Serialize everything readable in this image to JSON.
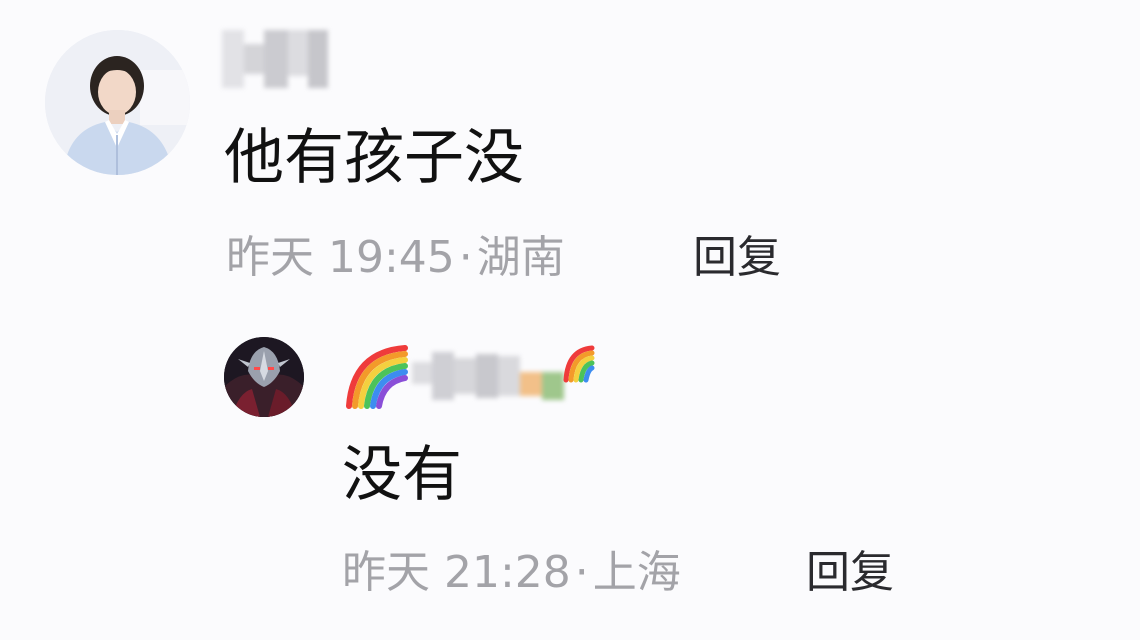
{
  "thread": {
    "comment": {
      "author_avatar": "woman-portrait-avatar",
      "author_name_hidden": true,
      "text": "他有孩子没",
      "time": "昨天 19:45",
      "separator": "·",
      "location": "湖南",
      "reply_label": "回复"
    },
    "reply": {
      "author_avatar": "armored-hero-avatar",
      "author_name_hidden": true,
      "name_decoration": "rainbow-emoji",
      "text": "没有",
      "time": "昨天 21:28",
      "separator": "·",
      "location": "上海",
      "reply_label": "回复"
    }
  },
  "colors": {
    "background": "#fbfbfd",
    "text": "#111111",
    "meta": "#a3a3a8",
    "action": "#2a2a2e"
  }
}
